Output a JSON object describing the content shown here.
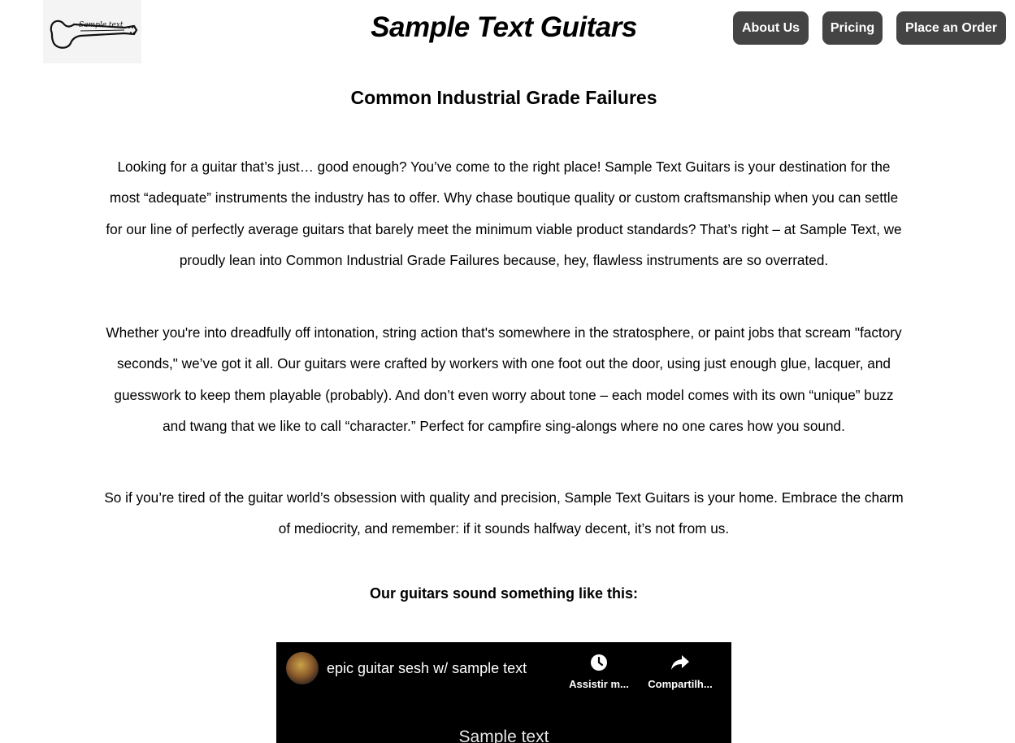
{
  "header": {
    "logo_text": "Sample text",
    "site_title": "Sample Text Guitars",
    "nav": [
      {
        "label": "About Us"
      },
      {
        "label": "Pricing"
      },
      {
        "label": "Place an Order"
      }
    ],
    "nav_button_color": "#444444"
  },
  "main": {
    "heading": "Common Industrial Grade Failures",
    "paragraphs": [
      "Looking for a guitar that’s just… good enough? You’ve come to the right place! Sample Text Guitars is your destination for the most “adequate” instruments the industry has to offer. Why chase boutique quality or custom craftsmanship when you can settle for our line of perfectly average guitars that barely meet the minimum viable product standards? That’s right – at Sample Text, we proudly lean into Common Industrial Grade Failures because, hey, flawless instruments are so overrated.",
      "Whether you're into dreadfully off intonation, string action that's somewhere in the stratosphere, or paint jobs that scream \"factory seconds,\" we’ve got it all. Our guitars were crafted by workers with one foot out the door, using just enough glue, lacquer, and guesswork to keep them playable (probably). And don’t even worry about tone – each model comes with its own “unique” buzz and twang that we like to call “character.” Perfect for campfire sing-alongs where no one cares how you sound.",
      "So if you’re tired of the guitar world’s obsession with quality and precision, Sample Text Guitars is your home. Embrace the charm of mediocrity, and remember: if it sounds halfway decent, it’s not from us."
    ],
    "subheading": "Our guitars sound something like this:"
  },
  "video": {
    "title": "epic guitar sesh w/ sample text",
    "watch_later_label": "Assistir m...",
    "share_label": "Compartilh...",
    "caption": "Sample text",
    "icons": [
      "channel-avatar",
      "clock-icon",
      "share-arrow-icon"
    ]
  }
}
